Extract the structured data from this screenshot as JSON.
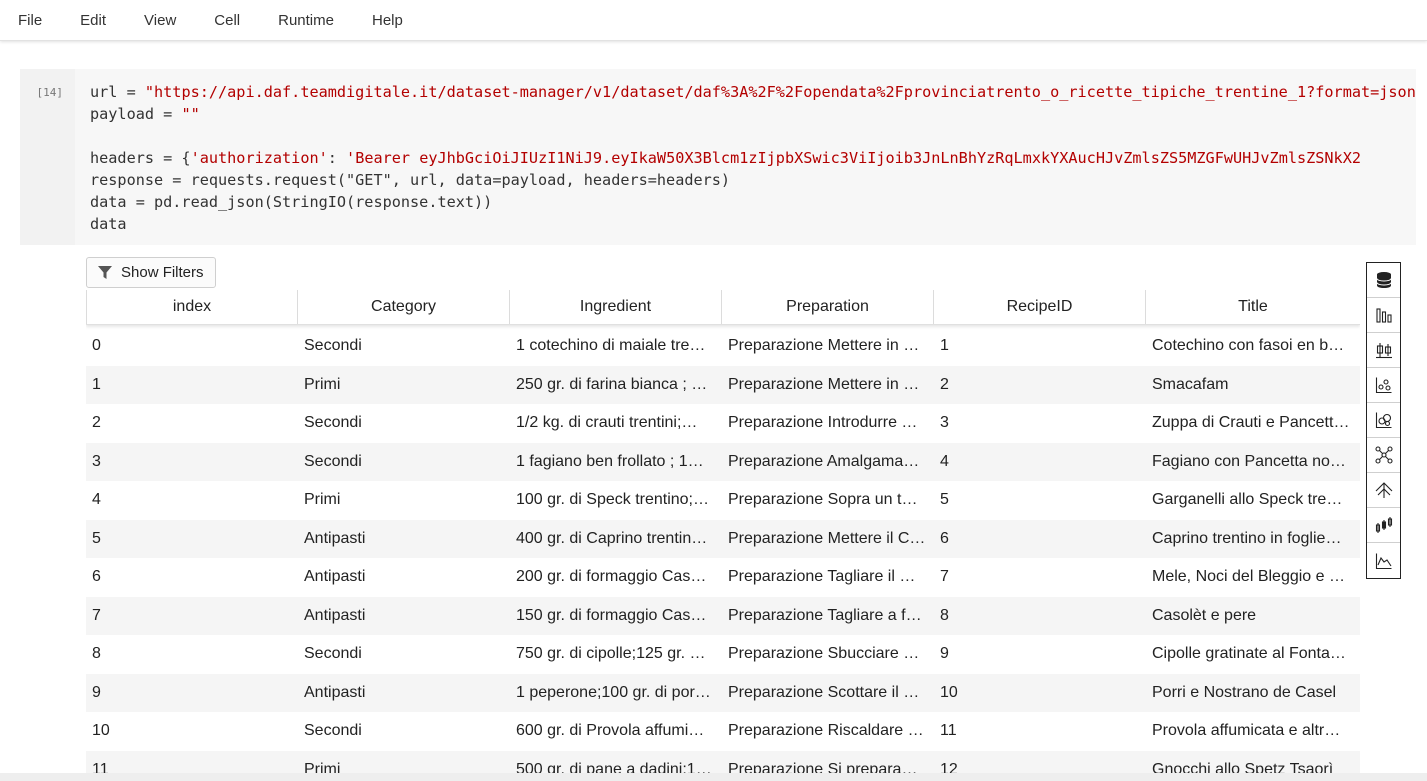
{
  "menu": {
    "file": "File",
    "edit": "Edit",
    "view": "View",
    "cell": "Cell",
    "runtime": "Runtime",
    "help": "Help"
  },
  "cell": {
    "prompt": "[14]",
    "code": {
      "line1_pre": "url = ",
      "line1_str": "\"https://api.daf.teamdigitale.it/dataset-manager/v1/dataset/daf%3A%2F%2Fopendata%2Fprovinciatrento_o_ricette_tipiche_trentine_1?format=json\"",
      "line2_pre": "payload = ",
      "line2_str": "\"\"",
      "line4_pre": "headers = {",
      "line4_str1": "'authorization'",
      "line4_mid": ": ",
      "line4_str2": "'Bearer eyJhbGciOiJIUzI1NiJ9.eyIkaW50X3Blcm1zIjpbXSwic3ViIjoib3JnLnBhYzRqLmxkYXAucHJvZmlsZS5MZGFwUHJvZmlsZSNkX2",
      "line5": "response = requests.request(\"GET\", url, data=payload, headers=headers)",
      "line6": "data = pd.read_json(StringIO(response.text))",
      "line7": "data"
    }
  },
  "filters": {
    "label": "Show Filters",
    "icon": "filter-icon"
  },
  "table": {
    "columns": [
      "index",
      "Category",
      "Ingredient",
      "Preparation",
      "RecipeID",
      "Title"
    ],
    "rows": [
      [
        "0",
        "Secondi",
        "1 cotechino di maiale tre…",
        "Preparazione Mettere in …",
        "1",
        "Cotechino con fasoi en b…"
      ],
      [
        "1",
        "Primi",
        "250 gr. di farina bianca ; …",
        "Preparazione Mettere in …",
        "2",
        "Smacafam"
      ],
      [
        "2",
        "Secondi",
        "1/2 kg. di crauti trentini;…",
        "Preparazione Introdurre …",
        "3",
        "Zuppa di Crauti e Pancett…"
      ],
      [
        "3",
        "Secondi",
        "1 fagiano ben frollato ; 1…",
        "Preparazione Amalgama…",
        "4",
        "Fagiano con Pancetta no…"
      ],
      [
        "4",
        "Primi",
        "100 gr. di Speck trentino;…",
        "Preparazione Sopra un t…",
        "5",
        "Garganelli allo Speck tre…"
      ],
      [
        "5",
        "Antipasti",
        "400 gr. di Caprino trentin…",
        "Preparazione Mettere il C…",
        "6",
        "Caprino trentino in foglie…"
      ],
      [
        "6",
        "Antipasti",
        "200 gr. di formaggio Cas…",
        "Preparazione Tagliare il …",
        "7",
        "Mele, Noci del Bleggio e …"
      ],
      [
        "7",
        "Antipasti",
        "150 gr. di formaggio Cas…",
        "Preparazione Tagliare a f…",
        "8",
        "Casolèt e pere"
      ],
      [
        "8",
        "Secondi",
        "750 gr. di cipolle;125 gr. …",
        "Preparazione Sbucciare …",
        "9",
        "Cipolle gratinate al Fonta…"
      ],
      [
        "9",
        "Antipasti",
        "1 peperone;100 gr. di por…",
        "Preparazione Scottare il …",
        "10",
        "Porri e Nostrano de Casel"
      ],
      [
        "10",
        "Secondi",
        "600 gr. di Provola affumi…",
        "Preparazione Riscaldare …",
        "11",
        "Provola affumicata e altr…"
      ],
      [
        "11",
        "Primi",
        "500 gr. di pane a dadini;1…",
        "Preparazione Si prepara…",
        "12",
        "Gnocchi allo Spetz Tsaorì"
      ]
    ]
  },
  "toolbar": {
    "icons": [
      "database-icon",
      "bar-chart-icon",
      "box-plot-icon",
      "scatter-plot-icon",
      "bubble-chart-icon",
      "network-graph-icon",
      "tree-icon",
      "candlestick-icon",
      "line-chart-icon"
    ]
  }
}
